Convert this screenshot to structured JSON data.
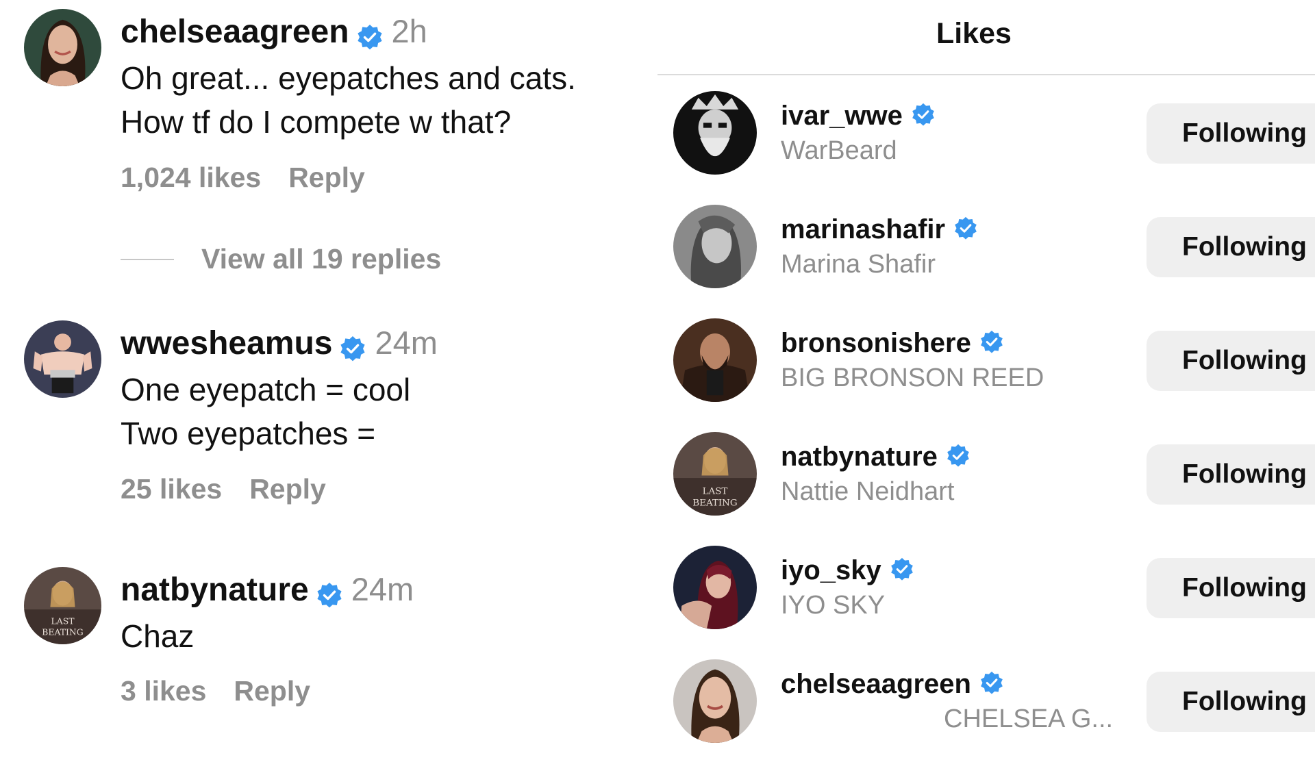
{
  "comments": [
    {
      "username": "chelseaagreen",
      "time": "2h",
      "lines": [
        "Oh great... eyepatches and cats.",
        "How tf do I compete w that?"
      ],
      "likes": "1,024 likes",
      "reply": "Reply",
      "view_replies": "View all 19 replies"
    },
    {
      "username": "wwesheamus",
      "time": "24m",
      "lines": [
        "One eyepatch = cool",
        "Two eyepatches ="
      ],
      "likes": "25 likes",
      "reply": "Reply"
    },
    {
      "username": "natbynature",
      "time": "24m",
      "lines": [
        "Chaz"
      ],
      "likes": "3 likes",
      "reply": "Reply"
    }
  ],
  "likes_panel": {
    "title": "Likes",
    "users": [
      {
        "username": "ivar_wwe",
        "name": "WarBeard",
        "button": "Following"
      },
      {
        "username": "marinashafir",
        "name": "Marina Shafir",
        "button": "Following"
      },
      {
        "username": "bronsonishere",
        "name": "BIG BRONSON REED",
        "button": "Following"
      },
      {
        "username": "natbynature",
        "name": "Nattie Neidhart",
        "button": "Following"
      },
      {
        "username": "iyo_sky",
        "name": "IYO SKY",
        "button": "Following"
      },
      {
        "username": "chelseaagreen",
        "name": "CHELSEA G...",
        "button": "Following"
      }
    ]
  },
  "colors": {
    "verified": "#3897f0",
    "muted_text": "#8e8e8e",
    "button_bg": "#efefef",
    "divider": "#dbdbdb"
  }
}
